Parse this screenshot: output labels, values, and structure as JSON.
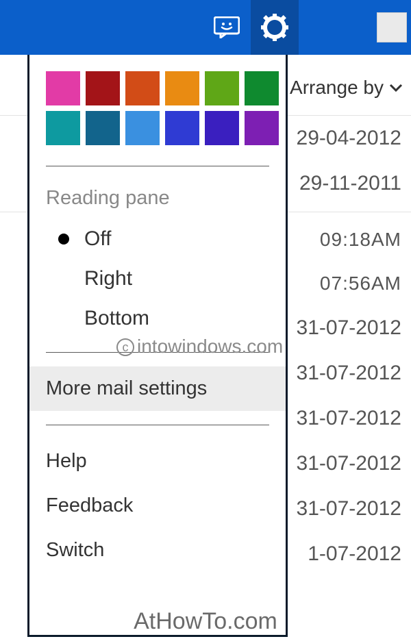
{
  "header": {
    "chat_icon": "chat-smiley-icon",
    "settings_icon": "gear-icon"
  },
  "arrange": {
    "label": "Arrange by"
  },
  "mail_rows": [
    "29-04-2012",
    "29-11-2011",
    "09:18AM",
    "07:56AM",
    "31-07-2012",
    "31-07-2012",
    "31-07-2012",
    "31-07-2012",
    "31-07-2012",
    "1-07-2012"
  ],
  "dropdown": {
    "colors_row1": [
      "#e23ba6",
      "#a31418",
      "#d24c17",
      "#e98b12",
      "#5fa717",
      "#0f8a2f"
    ],
    "colors_row2": [
      "#0e9aa0",
      "#12648c",
      "#3a90e0",
      "#2f3bd3",
      "#3a1fbf",
      "#7d1fb3"
    ],
    "reading_pane_heading": "Reading pane",
    "reading_pane_options": {
      "off": "Off",
      "right": "Right",
      "bottom": "Bottom"
    },
    "more_mail_settings": "More mail settings",
    "help": "Help",
    "feedback": "Feedback",
    "switch": "Switch"
  },
  "watermark1": "intowindows.com",
  "watermark2": "AtHowTo.com"
}
